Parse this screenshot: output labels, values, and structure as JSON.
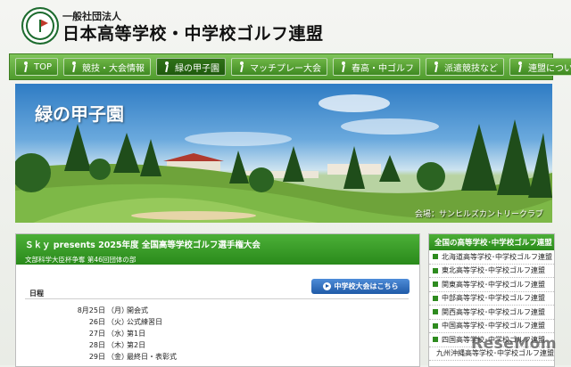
{
  "header": {
    "org_sub": "一般社団法人",
    "org_name": "日本高等学校・中学校ゴルフ連盟"
  },
  "nav": {
    "items": [
      {
        "label": "TOP",
        "active": false
      },
      {
        "label": "競技・大会情報",
        "active": false
      },
      {
        "label": "緑の甲子園",
        "active": true
      },
      {
        "label": "マッチプレー大会",
        "active": false
      },
      {
        "label": "春高・中ゴルフ",
        "active": false
      },
      {
        "label": "派遣競技など",
        "active": false
      },
      {
        "label": "連盟について",
        "active": false
      }
    ]
  },
  "banner": {
    "title": "緑の甲子園",
    "caption": "会場：サンヒルズカントリークラブ"
  },
  "main": {
    "title": "Ｓｋｙ presents 2025年度 全国高等学校ゴルフ選手権大会",
    "subtitle": "文部科学大臣杯争奪 第46回団体の部",
    "junior_button": "中学校大会はこちら",
    "schedule_label": "日程",
    "schedule": [
      {
        "date": "8月25日",
        "day": "（月）",
        "event": "開会式"
      },
      {
        "date": "26日",
        "day": "（火）",
        "event": "公式練習日"
      },
      {
        "date": "27日",
        "day": "（水）",
        "event": "第1日"
      },
      {
        "date": "28日",
        "day": "（木）",
        "event": "第2日"
      },
      {
        "date": "29日",
        "day": "（金）",
        "event": "最終日・表彰式"
      }
    ]
  },
  "sidebar": {
    "title": "全国の高等学校･中学校ゴルフ連盟",
    "items": [
      "北海道高等学校･中学校ゴルフ連盟",
      "東北高等学校･中学校ゴルフ連盟",
      "関東高等学校･中学校ゴルフ連盟",
      "中部高等学校･中学校ゴルフ連盟",
      "関西高等学校･中学校ゴルフ連盟",
      "中国高等学校･中学校ゴルフ連盟",
      "四国高等学校･中学校ゴルフ連盟",
      "九州沖縄高等学校･中学校ゴルフ連盟"
    ]
  },
  "watermark": "ReseMom",
  "colors": {
    "nav_green": "#4f9b2d",
    "active_green": "#1f5a0d",
    "button_blue": "#1f5aa7"
  }
}
